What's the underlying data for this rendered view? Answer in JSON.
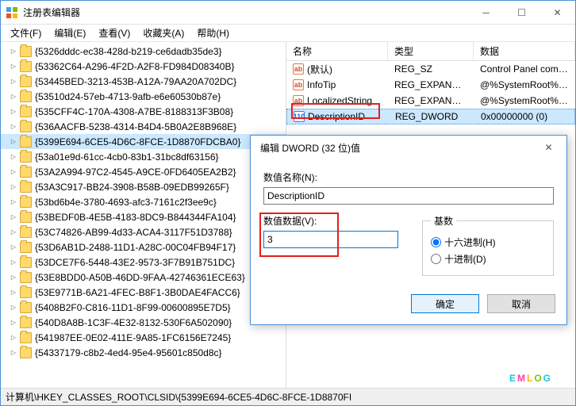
{
  "titlebar": {
    "title": "注册表编辑器"
  },
  "menubar": {
    "items": [
      {
        "label": "文件(F)"
      },
      {
        "label": "编辑(E)"
      },
      {
        "label": "查看(V)"
      },
      {
        "label": "收藏夹(A)"
      },
      {
        "label": "帮助(H)"
      }
    ]
  },
  "tree": {
    "items": [
      {
        "label": "{5326dddc-ec38-428d-b219-ce6dadb35de3}",
        "selected": false
      },
      {
        "label": "{53362C64-A296-4F2D-A2F8-FD984D08340B}",
        "selected": false
      },
      {
        "label": "{53445BED-3213-453B-A12A-79AA20A702DC}",
        "selected": false
      },
      {
        "label": "{53510d24-57eb-4713-9afb-e6e60530b87e}",
        "selected": false
      },
      {
        "label": "{535CFF4C-170A-4308-A7BE-8188313F3B08}",
        "selected": false
      },
      {
        "label": "{536AACFB-5238-4314-B4D4-5B0A2E8B968E}",
        "selected": false
      },
      {
        "label": "{5399E694-6CE5-4D6C-8FCE-1D8870FDCBA0}",
        "selected": true
      },
      {
        "label": "{53a01e9d-61cc-4cb0-83b1-31bc8df63156}",
        "selected": false
      },
      {
        "label": "{53A2A994-97C2-4545-A9CE-0FD6405EA2B2}",
        "selected": false
      },
      {
        "label": "{53A3C917-BB24-3908-B58B-09EDB99265F}",
        "selected": false
      },
      {
        "label": "{53bd6b4e-3780-4693-afc3-7161c2f3ee9c}",
        "selected": false
      },
      {
        "label": "{53BEDF0B-4E5B-4183-8DC9-B844344FA104}",
        "selected": false
      },
      {
        "label": "{53C74826-AB99-4d33-ACA4-3117F51D3788}",
        "selected": false
      },
      {
        "label": "{53D6AB1D-2488-11D1-A28C-00C04FB94F17}",
        "selected": false
      },
      {
        "label": "{53DCE7F6-5448-43E2-9573-3F7B91B751DC}",
        "selected": false
      },
      {
        "label": "{53E8BDD0-A50B-46DD-9FAA-42746361ECE63}",
        "selected": false
      },
      {
        "label": "{53E9771B-6A21-4FEC-B8F1-3B0DAE4FACC6}",
        "selected": false
      },
      {
        "label": "{5408B2F0-C816-11D1-8F99-00600895E7D5}",
        "selected": false
      },
      {
        "label": "{540D8A8B-1C3F-4E32-8132-530F6A502090}",
        "selected": false
      },
      {
        "label": "{541987EE-0E02-411E-9A85-1FC6156E7245}",
        "selected": false
      },
      {
        "label": "{54337179-c8b2-4ed4-95e4-95601c850d8c}",
        "selected": false
      }
    ]
  },
  "list": {
    "headers": {
      "name": "名称",
      "type": "类型",
      "data": "数据"
    },
    "rows": [
      {
        "icon": "str",
        "name": "(默认)",
        "type": "REG_SZ",
        "data": "Control Panel command",
        "selected": false
      },
      {
        "icon": "str",
        "name": "InfoTip",
        "type": "REG_EXPAND_SZ",
        "data": "@%SystemRoot%\\syster",
        "selected": false
      },
      {
        "icon": "str",
        "name": "LocalizedString",
        "type": "REG_EXPAND_SZ",
        "data": "@%SystemRoot%\\syster",
        "selected": false
      },
      {
        "icon": "bin",
        "name": "DescriptionID",
        "type": "REG_DWORD",
        "data": "0x00000000 (0)",
        "selected": true
      }
    ]
  },
  "dialog": {
    "title": "编辑 DWORD (32 位)值",
    "name_label": "数值名称(N):",
    "name_value": "DescriptionID",
    "data_label": "数值数据(V):",
    "data_value": "3",
    "base_legend": "基数",
    "radio_hex": "十六进制(H)",
    "radio_dec": "十进制(D)",
    "ok": "确定",
    "cancel": "取消"
  },
  "statusbar": {
    "path": "计算机\\HKEY_CLASSES_ROOT\\CLSID\\{5399E694-6CE5-4D6C-8FCE-1D8870FI"
  },
  "watermark": {
    "t0": "E",
    "t1": "M",
    "t2": "L",
    "t3": "O",
    "t4": "G"
  }
}
